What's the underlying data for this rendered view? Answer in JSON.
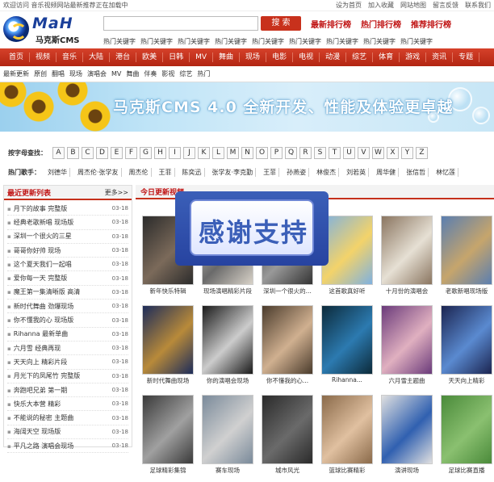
{
  "topbar": {
    "left": "欢迎访问 音乐视频网站最新推荐正在加载中",
    "links": [
      "设为首页",
      "加入收藏",
      "网站地图",
      "留言反馈",
      "联系我们"
    ]
  },
  "header": {
    "logo_text": "MaH",
    "logo_sub": "马克斯CMS",
    "search_placeholder": "",
    "search_button": "搜 索",
    "rank_links": [
      "最新排行榜",
      "热门排行榜",
      "推荐排行榜"
    ],
    "hotwords": [
      "热门关键字",
      "热门关键字",
      "热门关键字",
      "热门关键字",
      "热门关键字",
      "热门关键字",
      "热门关键字",
      "热门关键字",
      "热门关键字"
    ]
  },
  "nav": {
    "items": [
      "首页",
      "视频",
      "音乐",
      "大陆",
      "港台",
      "欧美",
      "日韩",
      "MV",
      "舞曲",
      "现场",
      "电影",
      "电视",
      "动漫",
      "综艺",
      "体育",
      "游戏",
      "资讯",
      "专题"
    ]
  },
  "subnav": {
    "items": [
      "最新更新",
      "原创",
      "翻唱",
      "现场",
      "演唱会",
      "MV",
      "舞曲",
      "伴奏",
      "影视",
      "综艺",
      "热门"
    ]
  },
  "banner": {
    "text": "马克斯CMS 4.0 全新开发、性能及体验更卓越"
  },
  "filter": {
    "letters_label": "按字母查找：",
    "letters": [
      "A",
      "B",
      "C",
      "D",
      "E",
      "F",
      "G",
      "H",
      "I",
      "J",
      "K",
      "L",
      "M",
      "N",
      "O",
      "P",
      "Q",
      "R",
      "S",
      "T",
      "U",
      "V",
      "W",
      "X",
      "Y",
      "Z"
    ],
    "singers_label": "热门歌手：",
    "singers": [
      "刘德华",
      "周杰伦·张学友",
      "周杰伦",
      "王菲",
      "陈奕迅",
      "张学友·李克勤",
      "王菲",
      "孙燕姿",
      "林俊杰",
      "刘若英",
      "周华健",
      "张信哲",
      "林忆莲"
    ]
  },
  "left": {
    "title": "最近更新列表",
    "more": "更多>>",
    "items": [
      {
        "title": "月下的故事 完整版",
        "date": "03-18"
      },
      {
        "title": "经典老歌新唱 现场版",
        "date": "03-18"
      },
      {
        "title": "深圳一个很火的三星",
        "date": "03-18"
      },
      {
        "title": "哥哥你好帅 现场",
        "date": "03-18"
      },
      {
        "title": "这个夏天我们一起唱",
        "date": "03-18"
      },
      {
        "title": "爱你每一天 完整版",
        "date": "03-18"
      },
      {
        "title": "魔王第一集清晰版 高清",
        "date": "03-18"
      },
      {
        "title": "新时代舞曲 劲爆现场",
        "date": "03-18"
      },
      {
        "title": "你不懂我的心 现场版",
        "date": "03-18"
      },
      {
        "title": "Rihanna 最新单曲",
        "date": "03-18"
      },
      {
        "title": "六月雪 经典再现",
        "date": "03-18"
      },
      {
        "title": "天天向上 精彩片段",
        "date": "03-18"
      },
      {
        "title": "月光下的凤尾竹 完整版",
        "date": "03-18"
      },
      {
        "title": "奔跑吧兄弟 第一期",
        "date": "03-18"
      },
      {
        "title": "快乐大本营 精彩",
        "date": "03-18"
      },
      {
        "title": "不能说的秘密 主题曲",
        "date": "03-18"
      },
      {
        "title": "海阔天空 现场版",
        "date": "03-18"
      },
      {
        "title": "平凡之路 演唱会现场",
        "date": "03-18"
      }
    ]
  },
  "right": {
    "title": "今日更新视频",
    "cards": [
      {
        "caption": "新年快乐特辑"
      },
      {
        "caption": "现场演唱精彩片段"
      },
      {
        "caption": "深圳一个很火的..."
      },
      {
        "caption": "这首歌真好听"
      },
      {
        "caption": "十月份的演唱会"
      },
      {
        "caption": "老歌新唱现场版"
      },
      {
        "caption": "新时代舞曲现场"
      },
      {
        "caption": "你的演唱会现场"
      },
      {
        "caption": "你不懂我的心..."
      },
      {
        "caption": "Rihanna..."
      },
      {
        "caption": "六月雪主题曲"
      },
      {
        "caption": "天天向上精彩"
      },
      {
        "caption": "足球精彩集锦"
      },
      {
        "caption": "赛车现场"
      },
      {
        "caption": "城市风光"
      },
      {
        "caption": "篮球比赛精彩"
      },
      {
        "caption": "演讲现场"
      },
      {
        "caption": "足球比赛直播"
      }
    ]
  },
  "overlay": {
    "text": "感谢支持"
  }
}
